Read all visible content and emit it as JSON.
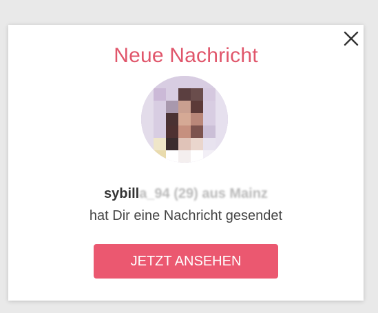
{
  "modal": {
    "title": "Neue Nachricht",
    "close_icon": "close-icon",
    "sender": {
      "name_visible": "sybill",
      "name_obscured": "a_94 (29) aus Mainz"
    },
    "message": "hat Dir eine Nachricht gesendet",
    "cta_label": "JETZT ANSEHEN"
  },
  "colors": {
    "accent": "#e0566b",
    "button": "#eb5870"
  }
}
